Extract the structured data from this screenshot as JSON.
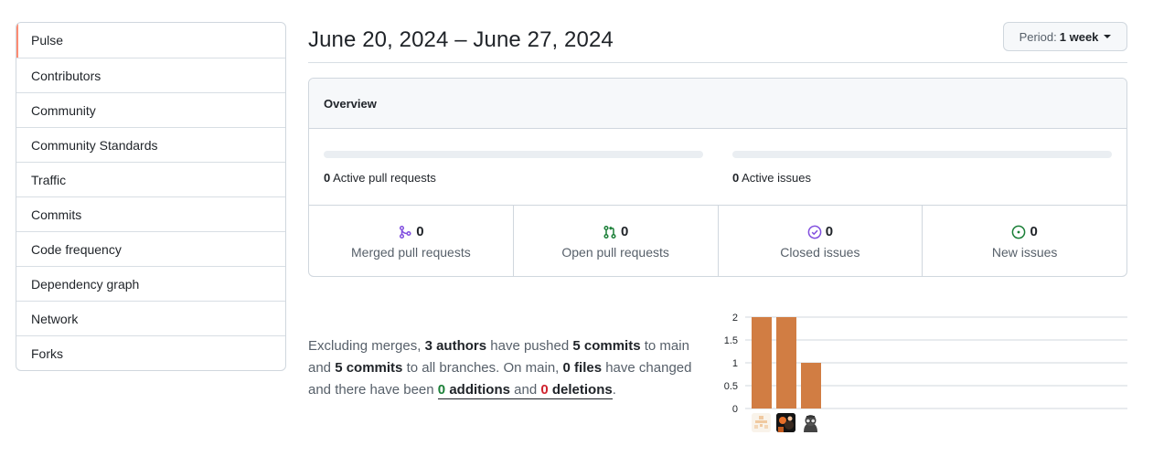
{
  "sidebar": {
    "items": [
      {
        "label": "Pulse",
        "selected": true
      },
      {
        "label": "Contributors"
      },
      {
        "label": "Community"
      },
      {
        "label": "Community Standards"
      },
      {
        "label": "Traffic"
      },
      {
        "label": "Commits"
      },
      {
        "label": "Code frequency"
      },
      {
        "label": "Dependency graph"
      },
      {
        "label": "Network"
      },
      {
        "label": "Forks"
      }
    ]
  },
  "header": {
    "date_range": "June 20, 2024 – June 27, 2024",
    "period_label": "Period:",
    "period_value": "1 week"
  },
  "overview": {
    "title": "Overview",
    "active_pull_requests": {
      "count": "0",
      "label": "Active pull requests"
    },
    "active_issues": {
      "count": "0",
      "label": "Active issues"
    },
    "stats": [
      {
        "count": "0",
        "label": "Merged pull requests",
        "icon": "git-merge-icon",
        "color": "#8250df"
      },
      {
        "count": "0",
        "label": "Open pull requests",
        "icon": "git-pull-request-icon",
        "color": "#1a7f37"
      },
      {
        "count": "0",
        "label": "Closed issues",
        "icon": "issue-closed-icon",
        "color": "#8250df"
      },
      {
        "count": "0",
        "label": "New issues",
        "icon": "issue-opened-icon",
        "color": "#1a7f37"
      }
    ]
  },
  "commit_summary": {
    "t1": "Excluding merges,",
    "authors": "3 authors",
    "t2": "have pushed",
    "commits_main": "5 commits",
    "t3": "to main and",
    "commits_all": "5 commits",
    "t4": "to all branches. On main,",
    "files": "0 files",
    "t5": "have changed and there have been",
    "additions_num": "0",
    "additions_word": "additions",
    "and": "and",
    "deletions_num": "0",
    "deletions_word": "deletions",
    "end": "."
  },
  "chart_data": {
    "type": "bar",
    "categories": [
      "contributor-1",
      "contributor-2",
      "contributor-3"
    ],
    "values": [
      2,
      2,
      1
    ],
    "ylim": [
      0,
      2
    ],
    "yticks": [
      "0",
      "0.5",
      "1",
      "1.5",
      "2"
    ],
    "bar_color": "#d17d43",
    "grid": true
  }
}
